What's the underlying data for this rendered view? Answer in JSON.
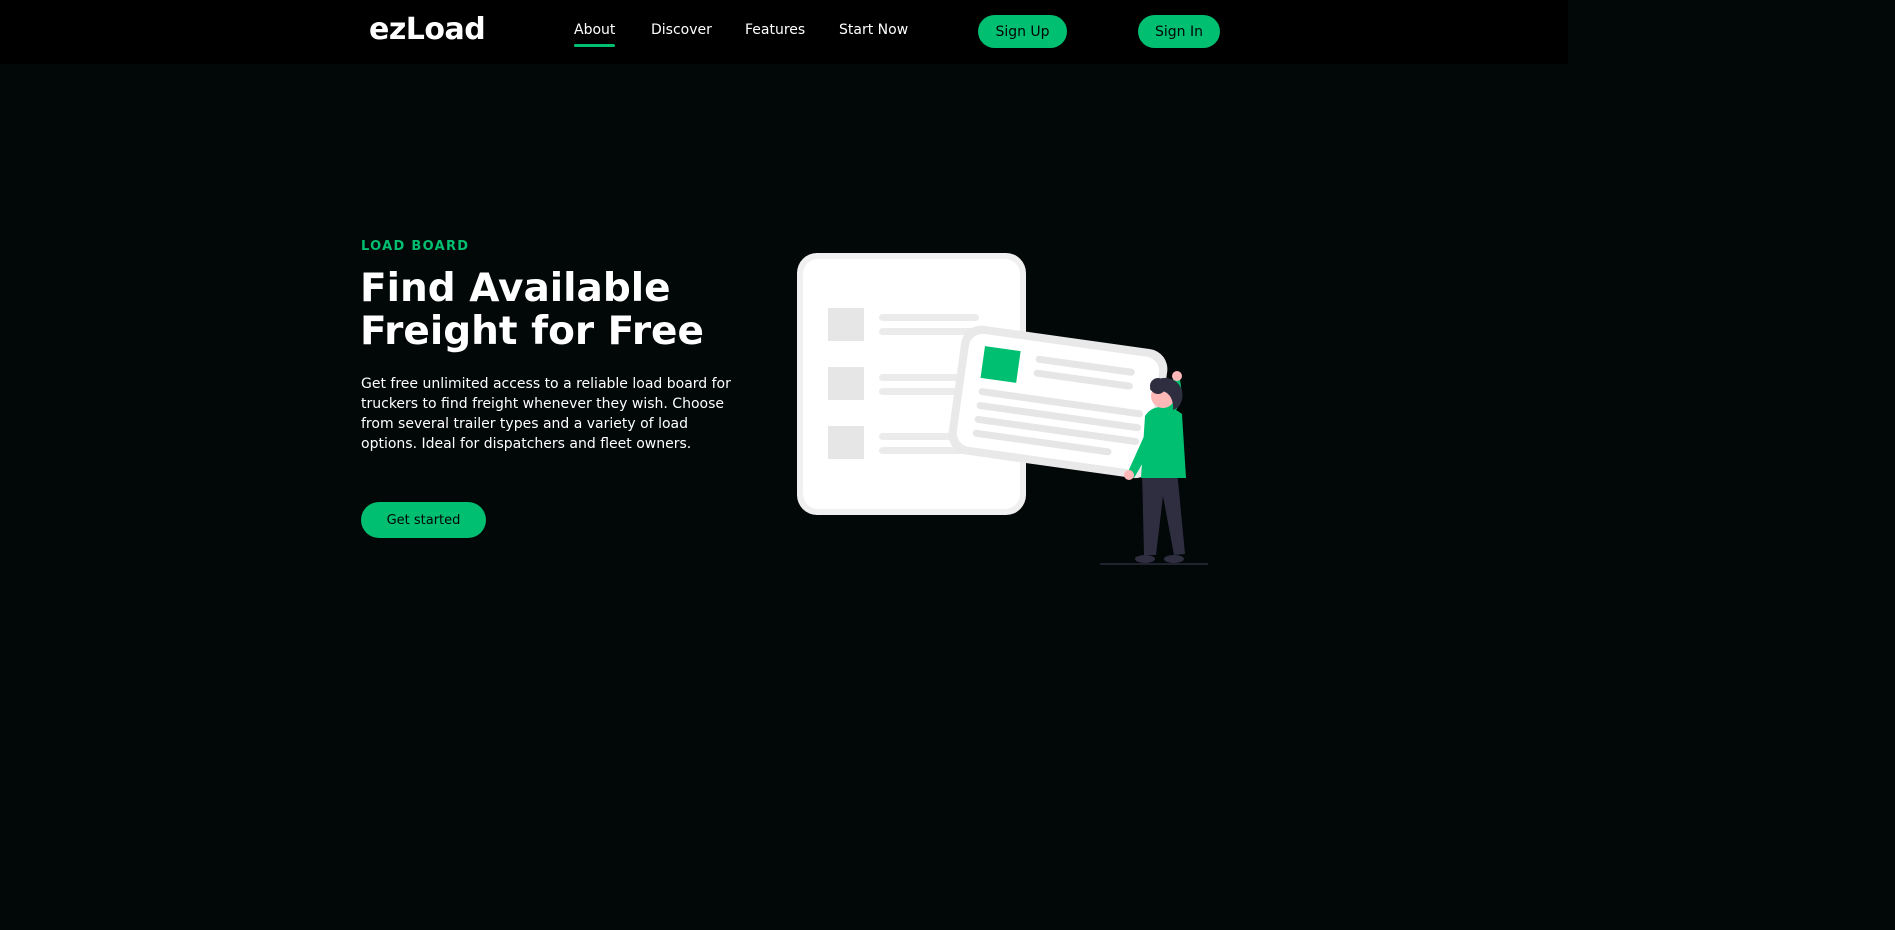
{
  "navbar": {
    "logo": "ezLoad",
    "links": [
      {
        "label": "About",
        "active": true
      },
      {
        "label": "Discover",
        "active": false
      },
      {
        "label": "Features",
        "active": false
      },
      {
        "label": "Start Now",
        "active": false
      }
    ],
    "sign_up_label": "Sign Up",
    "sign_in_label": "Sign In"
  },
  "hero": {
    "eyebrow": "LOAD BOARD",
    "headline": "Find Available Freight for Free",
    "description": "Get free unlimited access to a reliable load board for truckers to find freight whenever they wish. Choose from several trailer types and a variety of load options. Ideal for dispatchers and fleet owners.",
    "cta_label": "Get started"
  },
  "illustration": {
    "icon": "person-holding-card-illustration"
  },
  "colors": {
    "background": "#020707",
    "navbar_background": "#000000",
    "accent": "#01bf71",
    "button_text": "#010606"
  }
}
